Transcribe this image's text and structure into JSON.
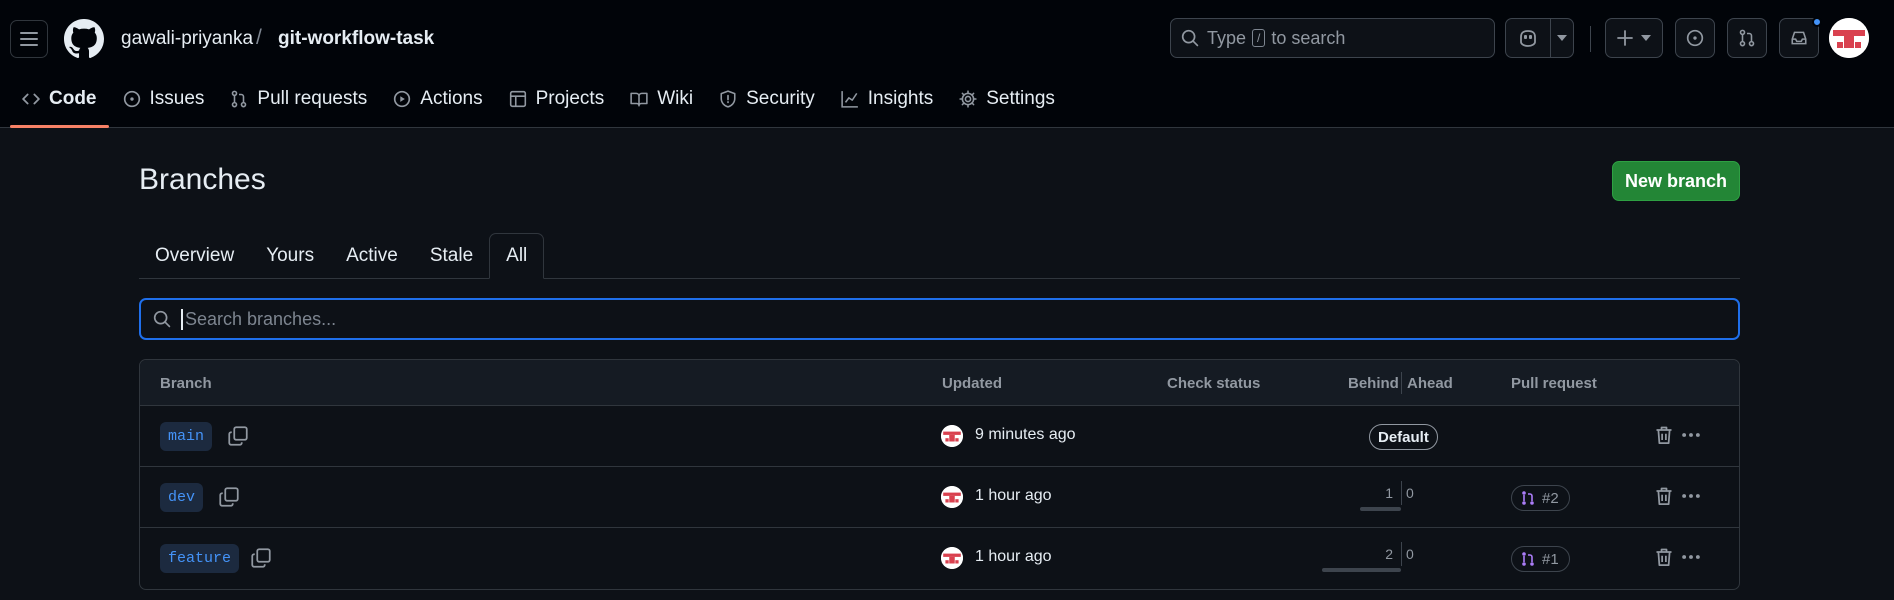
{
  "header": {
    "owner": "gawali-priyanka",
    "separator": "/",
    "repo": "git-workflow-task",
    "search_pre": "Type",
    "search_key": "/",
    "search_post": "to search"
  },
  "nav": [
    {
      "label": "Code",
      "icon": "code-icon",
      "active": true
    },
    {
      "label": "Issues",
      "icon": "issue-opened-icon"
    },
    {
      "label": "Pull requests",
      "icon": "git-pull-request-icon"
    },
    {
      "label": "Actions",
      "icon": "play-icon"
    },
    {
      "label": "Projects",
      "icon": "table-icon"
    },
    {
      "label": "Wiki",
      "icon": "book-icon"
    },
    {
      "label": "Security",
      "icon": "shield-icon"
    },
    {
      "label": "Insights",
      "icon": "graph-icon"
    },
    {
      "label": "Settings",
      "icon": "gear-icon"
    }
  ],
  "page": {
    "title": "Branches",
    "new_branch_label": "New branch"
  },
  "tabs": [
    {
      "label": "Overview"
    },
    {
      "label": "Yours"
    },
    {
      "label": "Active"
    },
    {
      "label": "Stale"
    },
    {
      "label": "All",
      "active": true
    }
  ],
  "branch_search": {
    "placeholder": "Search branches...",
    "value": ""
  },
  "table": {
    "headers": {
      "branch": "Branch",
      "updated": "Updated",
      "check_status": "Check status",
      "behind": "Behind",
      "ahead": "Ahead",
      "pull_request": "Pull request"
    },
    "rows": [
      {
        "branch": "main",
        "updated": "9 minutes ago",
        "default_label": "Default"
      },
      {
        "branch": "dev",
        "updated": "1 hour ago",
        "behind": "1",
        "ahead": "0",
        "pr": "#2"
      },
      {
        "branch": "feature",
        "updated": "1 hour ago",
        "behind": "2",
        "ahead": "0",
        "pr": "#1"
      }
    ]
  },
  "colors": {
    "accent_blue": "#4493f8",
    "primary_green": "#238636",
    "active_underline": "#f78166",
    "pr_open_purple": "#ab7df8"
  }
}
